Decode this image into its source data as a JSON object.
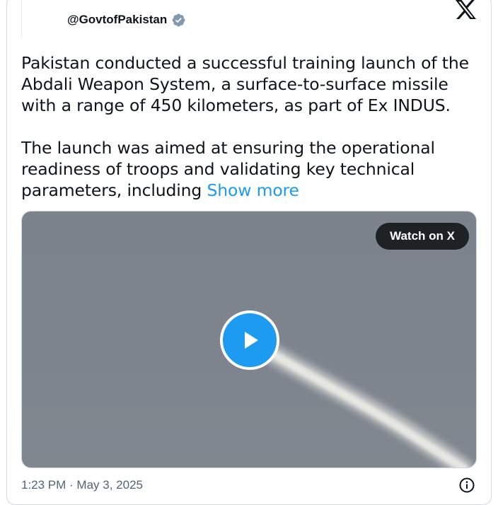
{
  "post": {
    "handle": "@GovtofPakistan",
    "paragraphs": [
      "Pakistan conducted a successful training launch of the Abdali Weapon System, a surface-to-surface missile with a range of 450 kilometers, as part of Ex INDUS.",
      "The launch was aimed at ensuring the operational readiness of troops and validating key technical parameters, including "
    ],
    "show_more": "Show more",
    "timestamp": "1:23 PM · May 3, 2025"
  },
  "media": {
    "watch_label": "Watch on X"
  },
  "icons": {
    "logo": "x-logo-icon",
    "verified": "verified-badge-icon",
    "play": "play-icon",
    "info": "info-icon"
  },
  "colors": {
    "accent": "#1d9bf0",
    "text": "#0f1419",
    "muted": "#536471"
  }
}
